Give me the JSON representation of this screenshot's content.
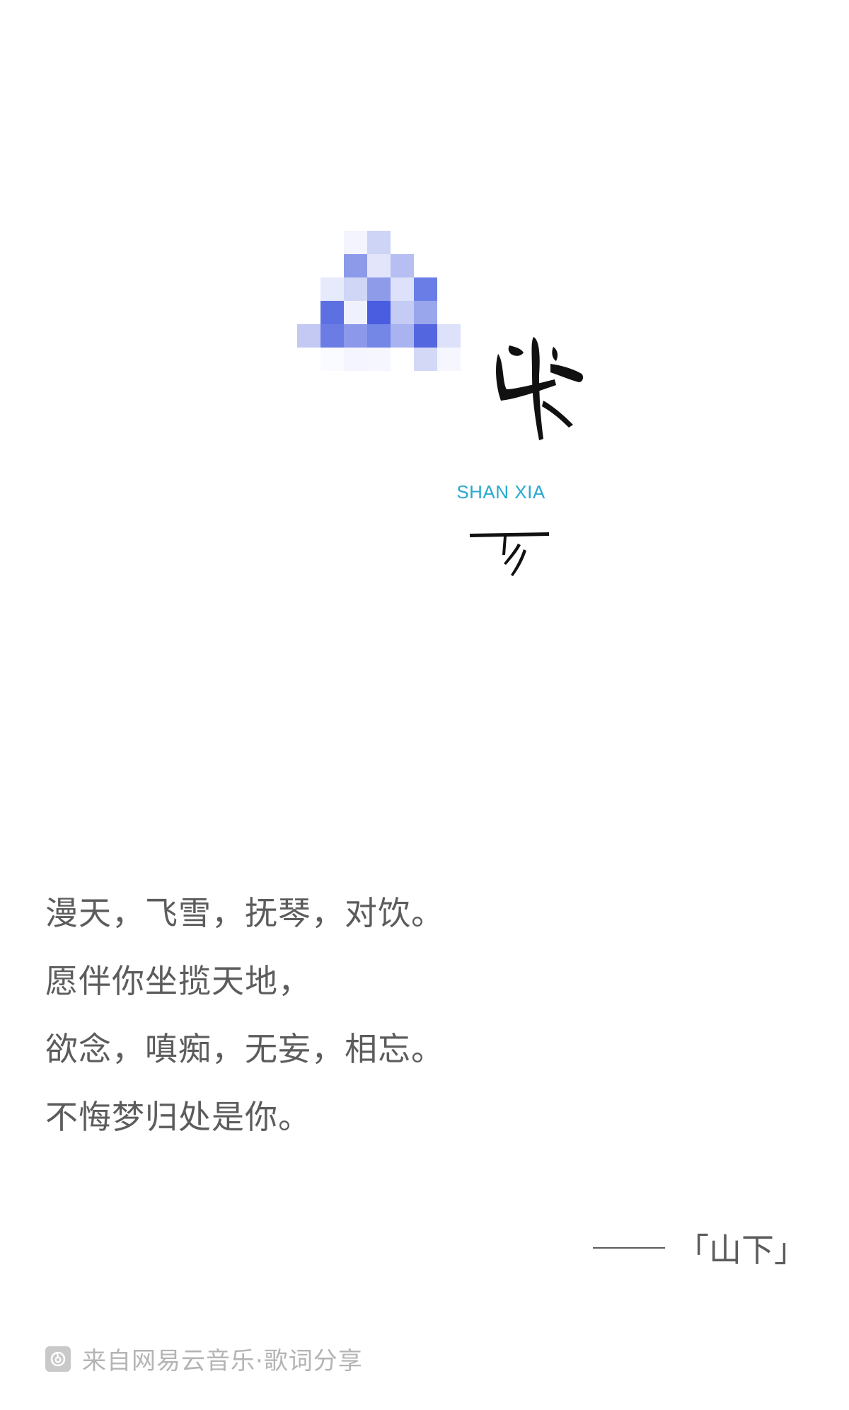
{
  "cover": {
    "pinyin": "SHAN XIA",
    "title_glyphs": [
      "山",
      "下"
    ],
    "palette": {
      "deep": "#4a5ce0",
      "mid": "#7f8ee8",
      "light": "#c3c9f3",
      "pale": "#e7eafb",
      "accent_text": "#27a9cf",
      "ink": "#111111"
    }
  },
  "lyrics": {
    "lines": [
      "漫天，飞雪，抚琴，对饮。",
      "愿伴你坐揽天地，",
      "欲念，嗔痴，无妄，相忘。",
      "不悔梦归处是你。"
    ]
  },
  "attribution": {
    "text": "「山下」"
  },
  "footer": {
    "icon": "netease-music-logo-icon",
    "text": "来自网易云音乐·歌词分享"
  }
}
